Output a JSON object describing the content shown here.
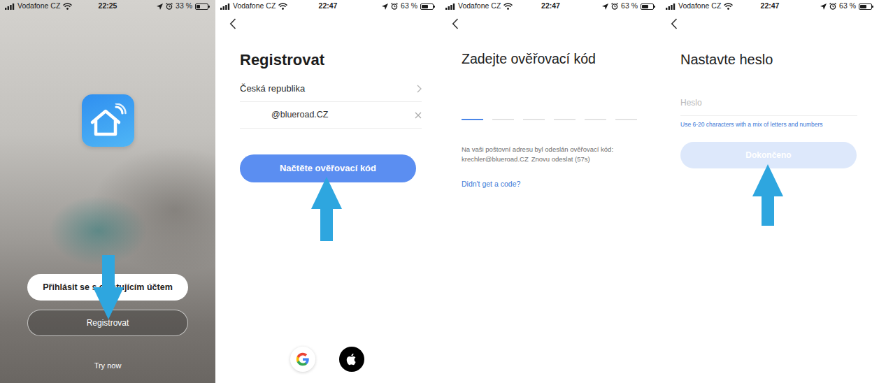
{
  "screens": [
    {
      "kind": "welcome",
      "status_bar": {
        "carrier": "Vodafone CZ",
        "time": "22:25",
        "battery": "33 %",
        "battery_level": 0.33
      },
      "login_button": "Přihlásit se s existujícím účtem",
      "register_button": "Registrovat",
      "try_now": "Try now",
      "arrow": {
        "direction": "down"
      }
    },
    {
      "kind": "register",
      "status_bar": {
        "carrier": "Vodafone CZ",
        "time": "22:47",
        "battery": "63 %",
        "battery_level": 0.63
      },
      "title": "Registrovat",
      "country": "Česká republika",
      "email": "@blueroad.CZ",
      "submit_button": "Načtěte ověřovací kód",
      "arrow": {
        "direction": "up"
      }
    },
    {
      "kind": "code",
      "status_bar": {
        "carrier": "Vodafone CZ",
        "time": "22:47",
        "battery": "63 %",
        "battery_level": 0.63
      },
      "title": "Zadejte ověřovací kód",
      "code_slots": [
        {
          "focused": true
        },
        {
          "focused": false
        },
        {
          "focused": false
        },
        {
          "focused": false
        },
        {
          "focused": false
        },
        {
          "focused": false
        }
      ],
      "message": "Na vaši poštovní adresu byl odeslán ověřovací kód:",
      "email_sent_to": "krechler@blueroad.CZ",
      "resend": "Znovu odeslat (57s)",
      "help_link": "Didn't get a code?"
    },
    {
      "kind": "password",
      "status_bar": {
        "carrier": "Vodafone CZ",
        "time": "22:47",
        "battery": "63 %",
        "battery_level": 0.63
      },
      "title": "Nastavte heslo",
      "password": {
        "placeholder": "Heslo"
      },
      "hint": "Use 6-20 characters with a mix of letters and numbers",
      "finish_button": {
        "label": "Dokončeno",
        "disabled": true
      },
      "arrow": {
        "direction": "up"
      }
    }
  ]
}
